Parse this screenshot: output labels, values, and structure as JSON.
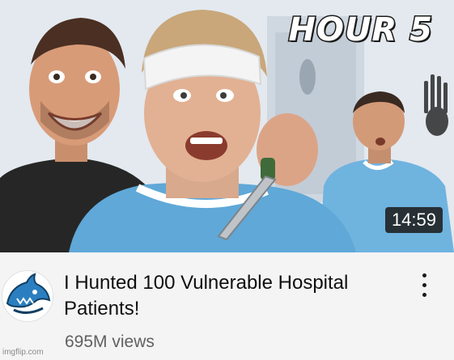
{
  "thumbnail": {
    "overlay_text": "HOUR 5",
    "duration": "14:59"
  },
  "video": {
    "title": "I Hunted 100 Vulnerable Hospital Patients!",
    "views": "695M views"
  },
  "channel": {
    "avatar_icon": "shark-logo-icon"
  },
  "menu": {
    "icon": "more-vertical-icon"
  },
  "watermark": "imgflip.com",
  "colors": {
    "gown": "#5fa8d8",
    "wall": "#dfe6ee",
    "avatar_accent": "#2b7fc0",
    "duration_bg": "#1e1e1e"
  }
}
